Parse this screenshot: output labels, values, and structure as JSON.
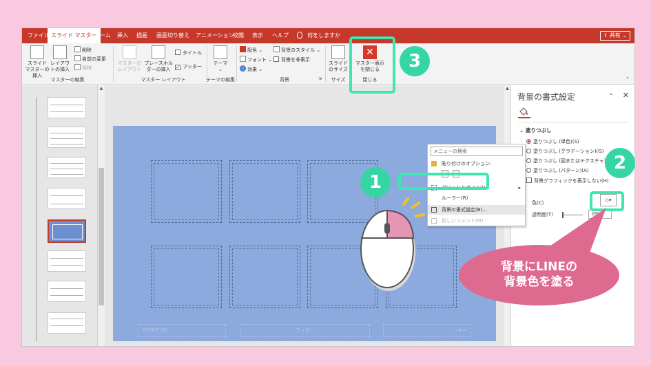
{
  "tabs": [
    "ファイル",
    "スライド マスター",
    "ホーム",
    "挿入",
    "描画",
    "画面切り替え",
    "アニメーション",
    "校閲",
    "表示",
    "ヘルプ",
    "何をしますか"
  ],
  "share_label": "共有",
  "ribbon": {
    "master_edit": {
      "insert_master": "スライド マスターの挿入",
      "insert_layout": "レイアウトの挿入",
      "delete": "削除",
      "rename": "名前の変更",
      "preserve": "保持",
      "label": "マスターの編集"
    },
    "master_layout": {
      "master_layout_btn": "マスターのレイアウト",
      "insert_placeholder": "プレースホルダーの挿入",
      "title_chk": "タイトル",
      "footer_chk": "フッター",
      "label": "マスター レイアウト"
    },
    "theme_edit": {
      "theme": "テーマ",
      "label": "テーマの編集"
    },
    "background": {
      "colors": "配色",
      "fonts": "フォント",
      "effects": "効果",
      "bg_styles": "背景のスタイル",
      "hide_bg": "背景を非表示",
      "label": "背景"
    },
    "size": {
      "slide_size": "スライドのサイズ",
      "label": "サイズ"
    },
    "close": {
      "close_master": "マスター表示を閉じる",
      "label": "閉じる"
    }
  },
  "slide": {
    "date_footer": "2020/7/30",
    "footer_text": "フッター",
    "page_num": "<#>"
  },
  "context_menu": {
    "search_placeholder": "メニューの検索",
    "paste_options": "貼り付けのオプション:",
    "grid_guides": "グリッドとガイド(I)...",
    "ruler": "ルーラー(R)",
    "format_bg": "背景の書式設定(B)...",
    "new_comment": "新しいコメント(M)"
  },
  "format_pane": {
    "title": "背景の書式設定",
    "fill_section": "塗りつぶし",
    "options": [
      "塗りつぶし (単色)(S)",
      "塗りつぶし (グラデーション)(G)",
      "塗りつぶし (図またはテクスチャ)(P)",
      "塗りつぶし (パターン)(A)"
    ],
    "hide_graphics": "背景グラフィックを表示しない(H)",
    "color_label": "色(C)",
    "transparency_label": "透明度(T)",
    "transparency_value": "0%"
  },
  "annotations": {
    "step1": "1",
    "step2": "2",
    "step3": "3",
    "callout_line1": "背景にLINEの",
    "callout_line2": "背景色を塗る"
  },
  "colors": {
    "accent_red": "#c5382a",
    "highlight_green": "#3ee6b0",
    "badge_green": "#35d6a4",
    "callout_pink": "#de6a90",
    "slide_blue": "#8daade",
    "page_bg": "#f9c9e0"
  }
}
